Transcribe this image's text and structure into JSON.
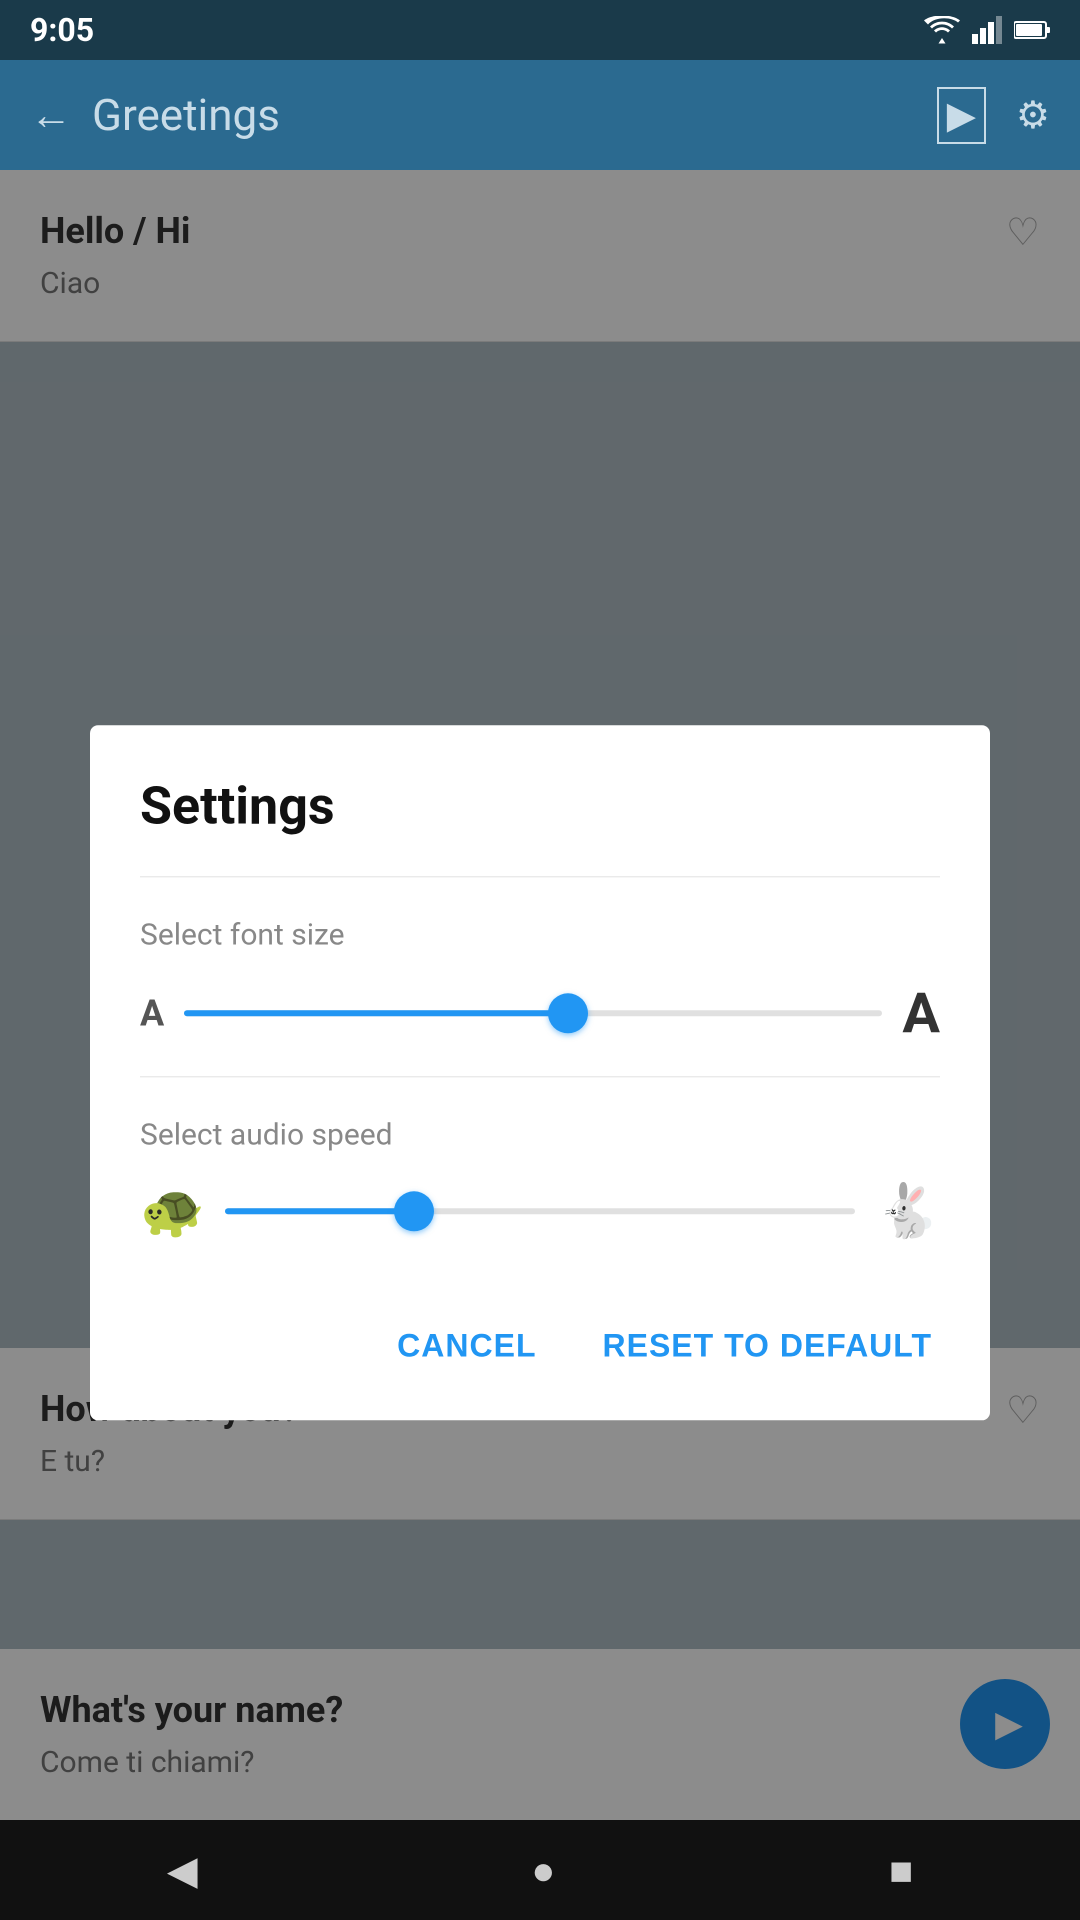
{
  "statusBar": {
    "time": "9:05",
    "icons": [
      "wifi",
      "signal",
      "battery"
    ]
  },
  "appBar": {
    "title": "Greetings",
    "backLabel": "←",
    "playIcon": "▶",
    "settingsIcon": "⚙"
  },
  "bgCards": [
    {
      "title": "Hello / Hi",
      "subtitle": "Ciao",
      "hasHeart": true
    },
    {
      "title": "How about you?",
      "subtitle": "E tu?",
      "hasHeart": true
    },
    {
      "title": "What's your name?",
      "subtitle": "Come ti chiami?",
      "hasPlay": true
    }
  ],
  "dialog": {
    "title": "Settings",
    "fontSizeLabel": "Select font size",
    "fontSizeValue": 55,
    "audioSpeedLabel": "Select audio speed",
    "audioSpeedValue": 30,
    "cancelLabel": "CANCEL",
    "resetLabel": "RESET TO DEFAULT"
  },
  "bottomNav": {
    "backIcon": "◀",
    "homeIcon": "●",
    "recentIcon": "■"
  }
}
